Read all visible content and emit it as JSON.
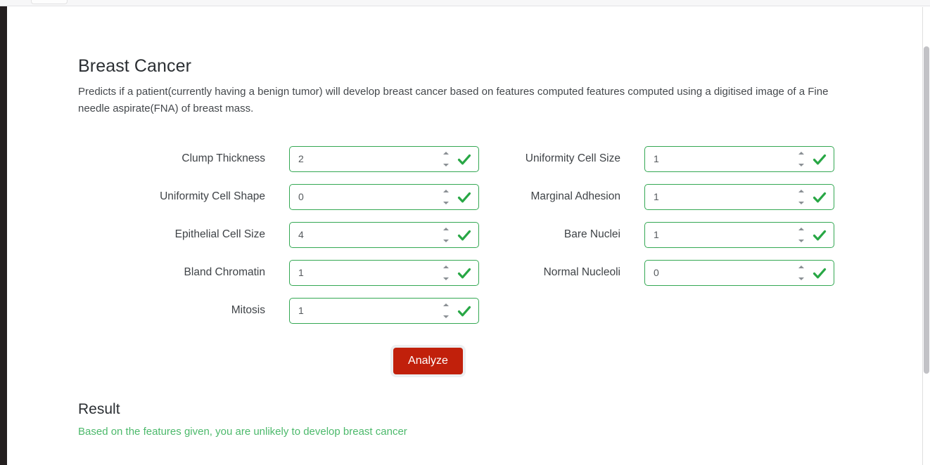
{
  "window": {
    "scrollbar": "vertical-scrollbar"
  },
  "page": {
    "title": "Breast Cancer",
    "description": "Predicts if a patient(currently having a benign tumor) will develop breast cancer based on features computed features computed using a digitised image of a Fine needle aspirate(FNA) of breast mass."
  },
  "form": {
    "fields": [
      {
        "label": "Clump Thickness",
        "value": "2",
        "valid": true,
        "column": "left"
      },
      {
        "label": "Uniformity Cell Size",
        "value": "1",
        "valid": true,
        "column": "right"
      },
      {
        "label": "Uniformity Cell Shape",
        "value": "0",
        "valid": true,
        "column": "left"
      },
      {
        "label": "Marginal Adhesion",
        "value": "1",
        "valid": true,
        "column": "right"
      },
      {
        "label": "Epithelial Cell Size",
        "value": "4",
        "valid": true,
        "column": "left"
      },
      {
        "label": "Bare Nuclei",
        "value": "1",
        "valid": true,
        "column": "right"
      },
      {
        "label": "Bland Chromatin",
        "value": "1",
        "valid": true,
        "column": "left"
      },
      {
        "label": "Normal Nucleoli",
        "value": "0",
        "valid": true,
        "column": "right"
      },
      {
        "label": "Mitosis",
        "value": "1",
        "valid": true,
        "column": "left"
      }
    ],
    "submit_label": "Analyze"
  },
  "result": {
    "title": "Result",
    "message": "Based on the features given, you are unlikely to develop breast cancer"
  },
  "colors": {
    "accent_red": "#c1200b",
    "valid_green": "#34a853",
    "check_green": "#28a745",
    "result_green": "#4cb96b",
    "title_text": "#2b2f33"
  }
}
